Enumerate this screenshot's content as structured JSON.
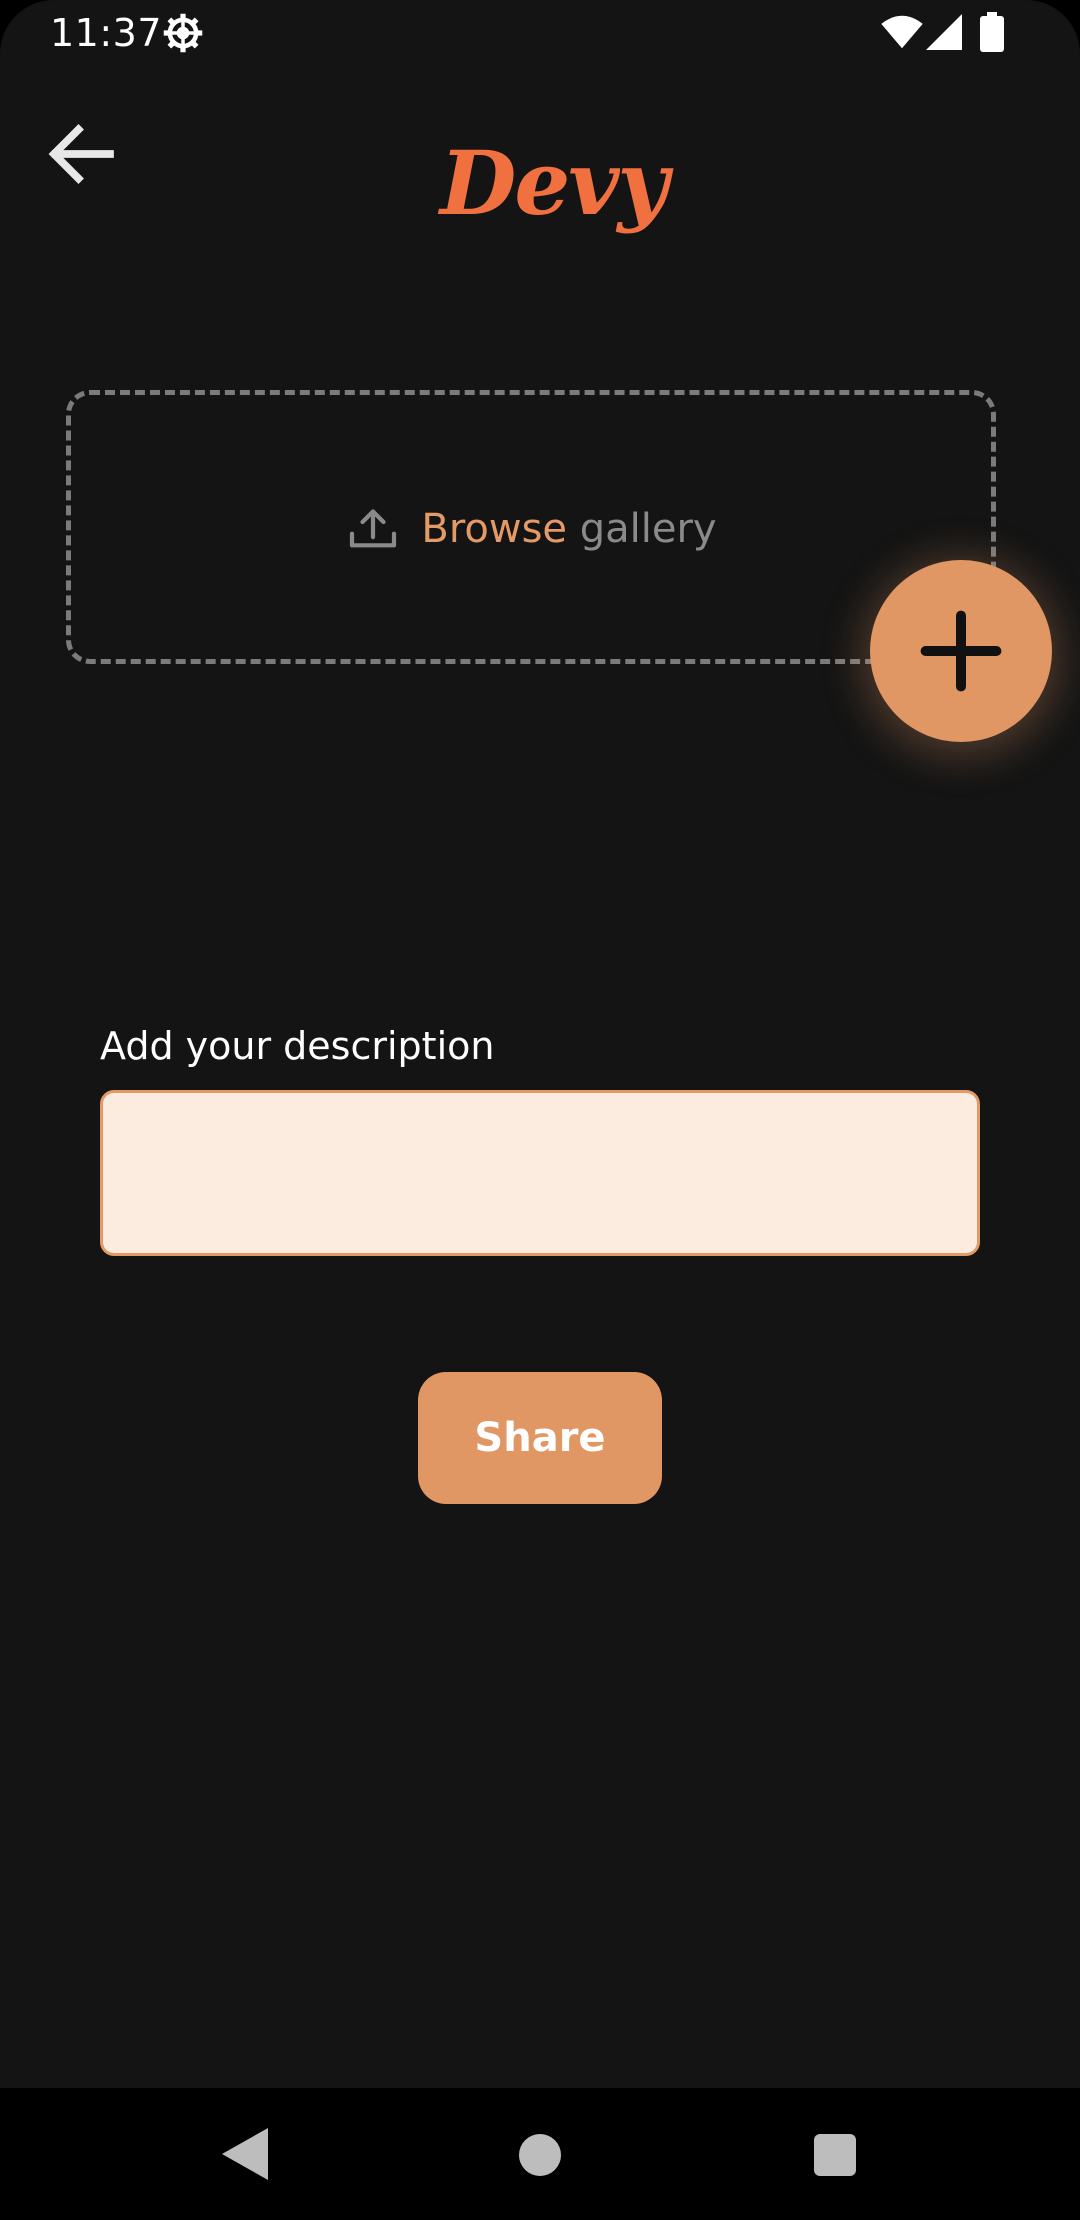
{
  "status_bar": {
    "time": "11:37",
    "icons": [
      "gear-icon",
      "wifi-icon",
      "signal-icon",
      "battery-icon"
    ]
  },
  "app_bar": {
    "back_icon": "arrow-left-icon",
    "logo_text": "Devy"
  },
  "upload": {
    "icon": "upload-icon",
    "browse_label": "Browse",
    "gallery_label": " gallery",
    "fab_icon": "plus-icon"
  },
  "description": {
    "label": "Add your description",
    "value": "",
    "placeholder": ""
  },
  "share_button": {
    "label": "Share"
  },
  "nav_bar": {
    "icons": [
      "nav-back-icon",
      "nav-home-icon",
      "nav-recents-icon"
    ]
  },
  "colors": {
    "background": "#141414",
    "accent": "#e09764",
    "logo": "#f0713f",
    "input_fill": "#fcebdf",
    "dashed_border": "#7b7b7b"
  }
}
